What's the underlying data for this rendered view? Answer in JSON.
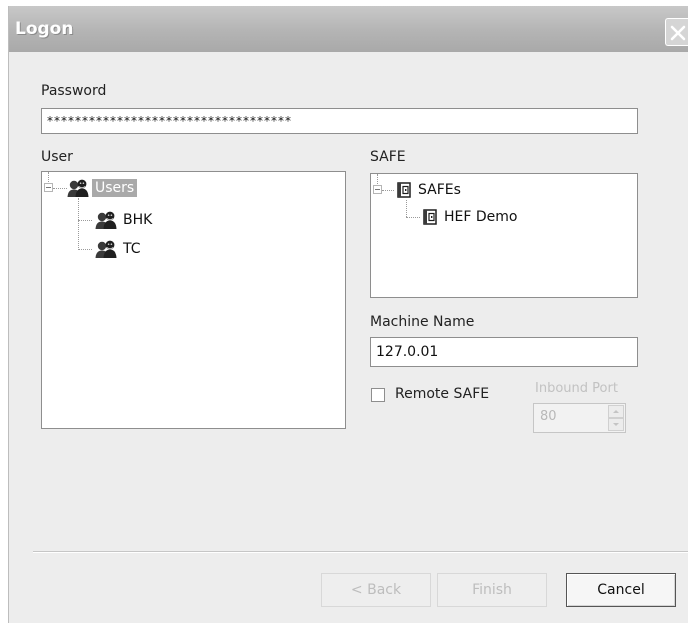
{
  "window": {
    "title": "Logon"
  },
  "password": {
    "label": "Password",
    "value": "***********************************"
  },
  "user": {
    "label": "User",
    "root": "Users",
    "children": [
      "BHK",
      "TC"
    ]
  },
  "safe": {
    "label": "SAFE",
    "root": "SAFEs",
    "children": [
      "HEF Demo"
    ]
  },
  "machine": {
    "label": "Machine Name",
    "value": "127.0.01"
  },
  "remote_safe": {
    "label": "Remote SAFE",
    "checked": false
  },
  "inbound_port": {
    "label": "Inbound Port",
    "value": "80"
  },
  "buttons": {
    "back": "< Back",
    "finish": "Finish",
    "cancel": "Cancel"
  },
  "colors": {
    "titlebar": "#b4b4b4",
    "selection": "#a9a9a9",
    "dialog_bg": "#ededed"
  },
  "icons": {
    "user": "users-group-icon",
    "safe": "safe-icon",
    "close": "close-icon"
  }
}
